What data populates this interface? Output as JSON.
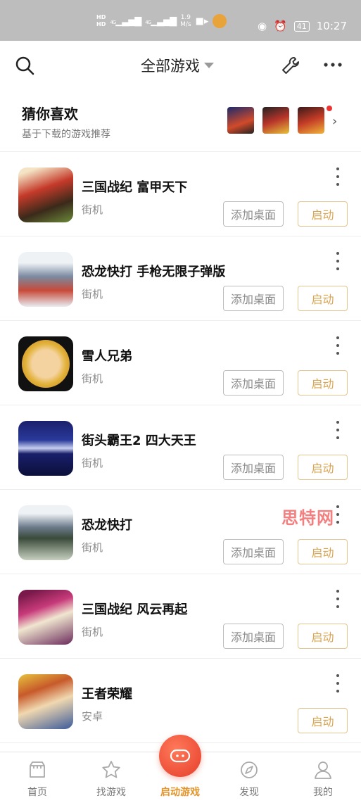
{
  "status_bar": {
    "hd1": "HD",
    "hd2": "HD",
    "network1": "4G",
    "network2": "4G",
    "speed_value": "1.9",
    "speed_unit": "M/s",
    "battery": "41",
    "time": "10:27"
  },
  "header": {
    "title": "全部游戏"
  },
  "recommend": {
    "title": "猜你喜欢",
    "subtitle": "基于下载的游戏推荐"
  },
  "games": [
    {
      "title": "三国战纪 富甲天下",
      "category": "街机",
      "add_label": "添加桌面",
      "start_label": "启动"
    },
    {
      "title": "恐龙快打 手枪无限子弹版",
      "category": "街机",
      "add_label": "添加桌面",
      "start_label": "启动"
    },
    {
      "title": "雪人兄弟",
      "category": "街机",
      "add_label": "添加桌面",
      "start_label": "启动"
    },
    {
      "title": "街头霸王2 四大天王",
      "category": "街机",
      "add_label": "添加桌面",
      "start_label": "启动"
    },
    {
      "title": "恐龙快打",
      "category": "街机",
      "add_label": "添加桌面",
      "start_label": "启动"
    },
    {
      "title": "三国战纪 风云再起",
      "category": "街机",
      "add_label": "添加桌面",
      "start_label": "启动"
    },
    {
      "title": "王者荣耀",
      "category": "安卓",
      "start_label": "启动"
    }
  ],
  "watermark": "思特网",
  "tabs": [
    {
      "label": "首页"
    },
    {
      "label": "找游戏"
    },
    {
      "label": "启动游戏"
    },
    {
      "label": "发现"
    },
    {
      "label": "我的"
    }
  ],
  "colors": {
    "accent": "#d9a552",
    "center_button": "#e53d2a",
    "status_bar": "#bdbdbd"
  }
}
